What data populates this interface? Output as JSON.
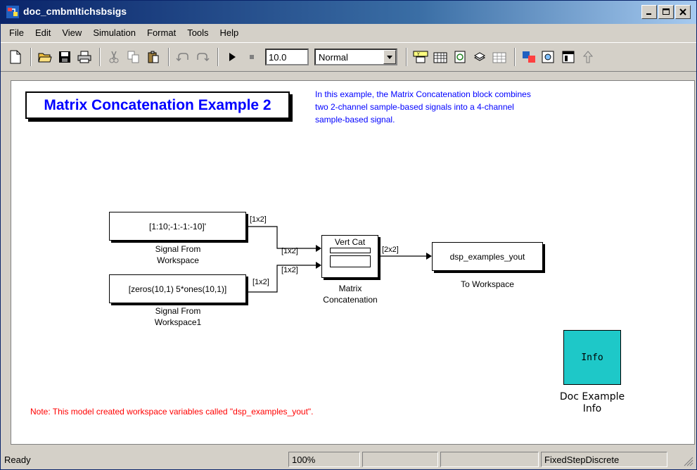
{
  "window": {
    "title": "doc_cmbmltichsbsigs"
  },
  "menu": [
    "File",
    "Edit",
    "View",
    "Simulation",
    "Format",
    "Tools",
    "Help"
  ],
  "toolbar": {
    "stop_time": "10.0",
    "sim_mode": "Normal"
  },
  "model": {
    "title": "Matrix Concatenation Example 2",
    "description": "In this example, the Matrix Concatenation block combines\ntwo 2-channel sample-based signals into a 4-channel\nsample-based signal.",
    "blocks": {
      "sfw1": {
        "text": "[1:10;-1:-1:-10]'",
        "label": "Signal From\nWorkspace"
      },
      "sfw2": {
        "text": "[zeros(10,1) 5*ones(10,1)]",
        "label": "Signal From\nWorkspace1"
      },
      "concat": {
        "text": "Vert Cat",
        "label": "Matrix\nConcatenation"
      },
      "toworkspace": {
        "text": "dsp_examples_yout",
        "label": "To Workspace"
      },
      "info": {
        "text": "Info",
        "label": "Doc Example\nInfo"
      }
    },
    "signals": {
      "s1_out": "[1x2]",
      "s1_in": "[1x2]",
      "s2_out": "[1x2]",
      "s2_in": "[1x2]",
      "concat_out": "[2x2]"
    },
    "note": "Note: This model created workspace variables called \"dsp_examples_yout\"."
  },
  "status": {
    "ready": "Ready",
    "zoom": "100%",
    "empty1": "",
    "empty2": "",
    "solver": "FixedStepDiscrete"
  },
  "colors": {
    "title_text": "#0000ff",
    "note_text": "#ff0000",
    "info_block": "#1ec8c8",
    "canvas": "#ffffff"
  }
}
